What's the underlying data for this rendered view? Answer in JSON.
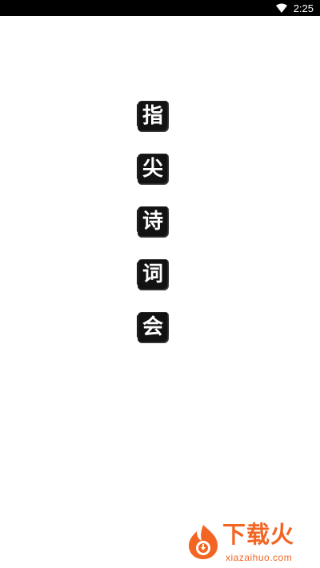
{
  "status_bar": {
    "time": "2:25",
    "wifi_icon": "wifi-icon"
  },
  "splash": {
    "title_chars": [
      "指",
      "尖",
      "诗",
      "词",
      "会"
    ]
  },
  "watermark": {
    "brand": "下载火",
    "domain": "xiazaihuo.com",
    "logo_icon": "flame-logo-icon",
    "color": "#f26522"
  }
}
